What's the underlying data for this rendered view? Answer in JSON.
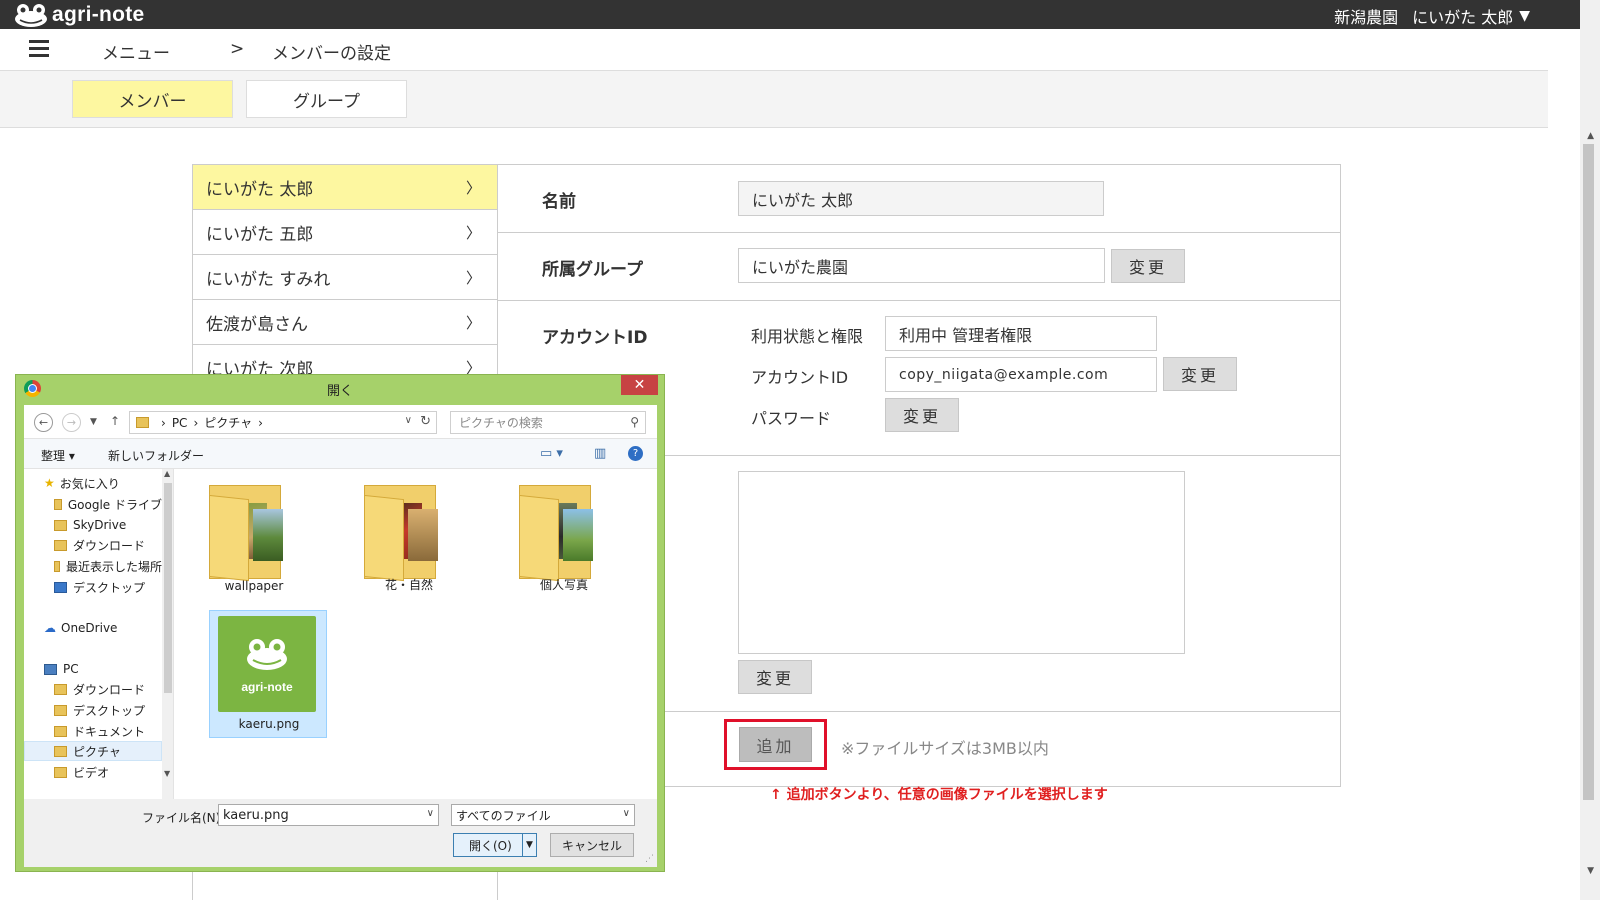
{
  "app": {
    "logo_text": "agri-note",
    "farm_name": "新潟農園",
    "user_name": "にいがた 太郎",
    "user_caret": "▼"
  },
  "breadcrumb": {
    "menu": "メニュー",
    "separator": ">",
    "current": "メンバーの設定"
  },
  "tabs": [
    {
      "label": "メンバー",
      "active": true
    },
    {
      "label": "グループ",
      "active": false
    }
  ],
  "members": [
    {
      "name": "にいがた 太郎",
      "chevron": "〉"
    },
    {
      "name": "にいがた 五郎",
      "chevron": "〉"
    },
    {
      "name": "にいがた すみれ",
      "chevron": "〉"
    },
    {
      "name": "佐渡が島さん",
      "chevron": "〉"
    },
    {
      "name": "にいがた 次郎",
      "chevron": "〉"
    }
  ],
  "details": {
    "name_label": "名前",
    "name_value": "にいがた 太郎",
    "group_label": "所属グループ",
    "group_value": "にいがた農園",
    "change_label": "変更",
    "account_label": "アカウントID",
    "status_label": "利用状態と権限",
    "status_value": "利用中 管理者権限",
    "account_id_label": "アカウントID",
    "account_id_value": "copy_niigata@example.com",
    "password_label": "パスワード",
    "add_label": "追加",
    "file_note": "※ファイルサイズは3MB以内",
    "annotation": "↑ 追加ボタンより、任意の画像ファイルを選択します"
  },
  "dialog": {
    "title": "開く",
    "close": "✕",
    "path": [
      "PC",
      "ピクチャ"
    ],
    "search_placeholder": "ピクチャの検索",
    "organize": "整理 ▾",
    "new_folder": "新しいフォルダー",
    "nav": [
      {
        "label": "お気に入り",
        "icon": "star-icon"
      },
      {
        "label": "Google ドライブ",
        "icon": "folder-icon"
      },
      {
        "label": "SkyDrive",
        "icon": "folder-icon"
      },
      {
        "label": "ダウンロード",
        "icon": "folder-icon"
      },
      {
        "label": "最近表示した場所",
        "icon": "folder-icon"
      },
      {
        "label": "デスクトップ",
        "icon": "desktop-icon"
      },
      {
        "label": "OneDrive",
        "icon": "cloud-icon"
      },
      {
        "label": "PC",
        "icon": "pc-icon"
      },
      {
        "label": "ダウンロード",
        "icon": "folder-icon"
      },
      {
        "label": "デスクトップ",
        "icon": "folder-icon"
      },
      {
        "label": "ドキュメント",
        "icon": "folder-icon"
      },
      {
        "label": "ピクチャ",
        "icon": "folder-icon",
        "selected": true
      },
      {
        "label": "ビデオ",
        "icon": "folder-icon"
      }
    ],
    "files": [
      {
        "name": "wallpaper",
        "type": "folder"
      },
      {
        "name": "花・自然",
        "type": "folder"
      },
      {
        "name": "個人写真",
        "type": "folder"
      },
      {
        "name": "kaeru.png",
        "type": "image",
        "selected": true,
        "image_text": "agri-note"
      }
    ],
    "filename_label": "ファイル名(N):",
    "filename_value": "kaeru.png",
    "filetype_value": "すべてのファイル",
    "open_label": "開く(O)",
    "cancel_label": "キャンセル"
  },
  "colors": {
    "topbar": "#333333",
    "active_yellow": "#fdf7a0",
    "dialog_frame": "#a6d16a",
    "highlight_red": "#e0102a",
    "brand_green": "#7cb542"
  }
}
